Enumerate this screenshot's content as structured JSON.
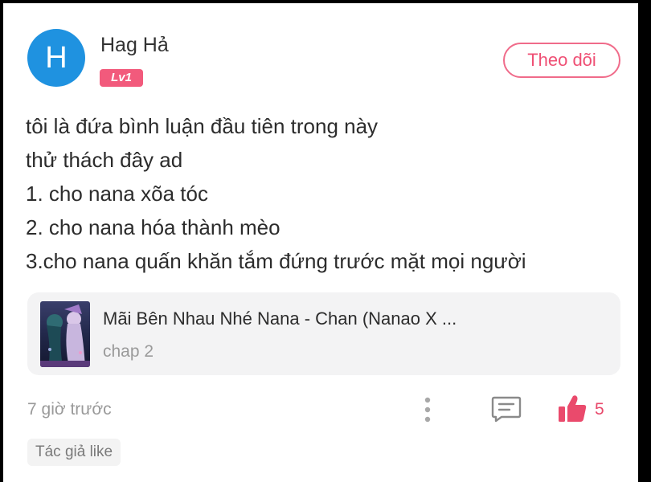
{
  "comment": {
    "author": {
      "avatar_letter": "H",
      "name": "Hag Hả",
      "level": "Lv1"
    },
    "follow_label": "Theo dõi",
    "lines": [
      "tôi là đứa bình luận đầu tiên trong này",
      "thử thách đây ad",
      "1. cho nana xõa tóc",
      "2. cho nana hóa thành mèo",
      "3.cho nana quấn khăn tắm đứng trước mặt mọi người"
    ],
    "manga": {
      "title": "Mãi Bên Nhau Nhé Nana - Chan (Nanao X ...",
      "chapter": "chap 2"
    },
    "timestamp": "7 giờ trước",
    "likes": "5",
    "author_like_tag": "Tác giả like"
  },
  "icons": {
    "more": "more-vertical-icon",
    "reply": "comment-icon",
    "like": "thumbs-up-icon"
  },
  "colors": {
    "avatar": "#1f92e0",
    "accent_pink": "#ef4f74",
    "level_badge": "#f25a7c"
  }
}
